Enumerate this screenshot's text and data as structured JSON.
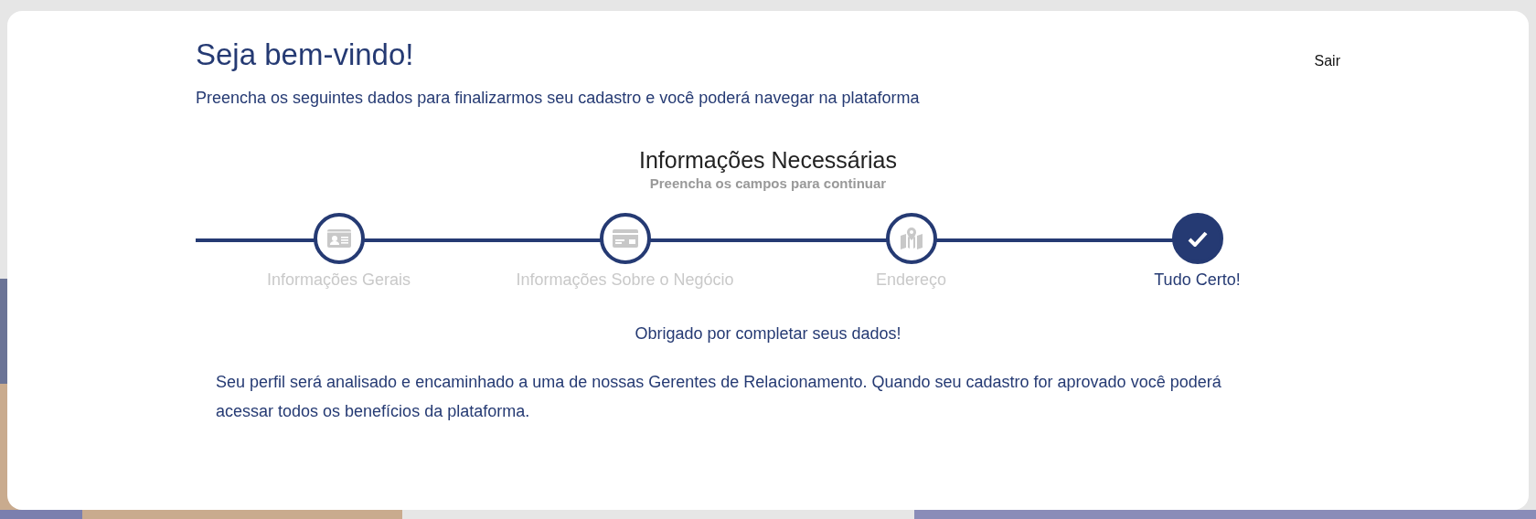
{
  "header": {
    "title": "Seja bem-vindo!",
    "subtitle": "Preencha os seguintes dados para finalizarmos seu cadastro e você poderá navegar na plataforma",
    "logout": "Sair"
  },
  "section": {
    "title": "Informações Necessárias",
    "subtitle": "Preencha os campos para continuar"
  },
  "steps": [
    {
      "label": "Informações Gerais",
      "kind": "profile",
      "selected": false
    },
    {
      "label": "Informações Sobre o Negócio",
      "kind": "business",
      "selected": false
    },
    {
      "label": "Endereço",
      "kind": "address",
      "selected": false
    },
    {
      "label": "Tudo Certo!",
      "kind": "final",
      "selected": true
    }
  ],
  "message": {
    "title": "Obrigado por completar seus dados!",
    "body": "Seu perfil será analisado e encaminhado a uma de nossas Gerentes de Relacionamento. Quando seu cadastro for aprovado você poderá acessar todos os benefícios da plataforma."
  }
}
